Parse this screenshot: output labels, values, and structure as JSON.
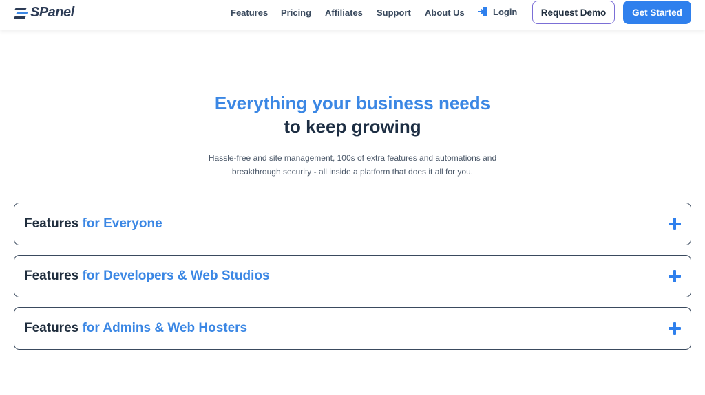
{
  "header": {
    "logo_text": "SPanel",
    "nav": [
      "Features",
      "Pricing",
      "Affiliates",
      "Support",
      "About Us"
    ],
    "login_label": "Login",
    "request_demo_label": "Request Demo",
    "get_started_label": "Get Started"
  },
  "hero": {
    "title_line1": "Everything your business needs",
    "title_line2": "to keep growing",
    "subtitle_line1": "Hassle-free and site management, 100s of extra features and automations and",
    "subtitle_line2": "breakthrough security - all inside a platform that does it all for you."
  },
  "accordions": [
    {
      "prefix": "Features",
      "highlight": "for Everyone"
    },
    {
      "prefix": "Features",
      "highlight": "for Developers & Web Studios"
    },
    {
      "prefix": "Features",
      "highlight": "for Admins & Web Hosters"
    }
  ],
  "colors": {
    "accent": "#3b87e4",
    "primary_button": "#2f80ed",
    "dark_text": "#1d2e43",
    "demo_border": "#7b6fd6"
  },
  "icons": {
    "logo": "spanel-logo-icon",
    "login": "login-door-icon",
    "expand": "plus-icon"
  }
}
